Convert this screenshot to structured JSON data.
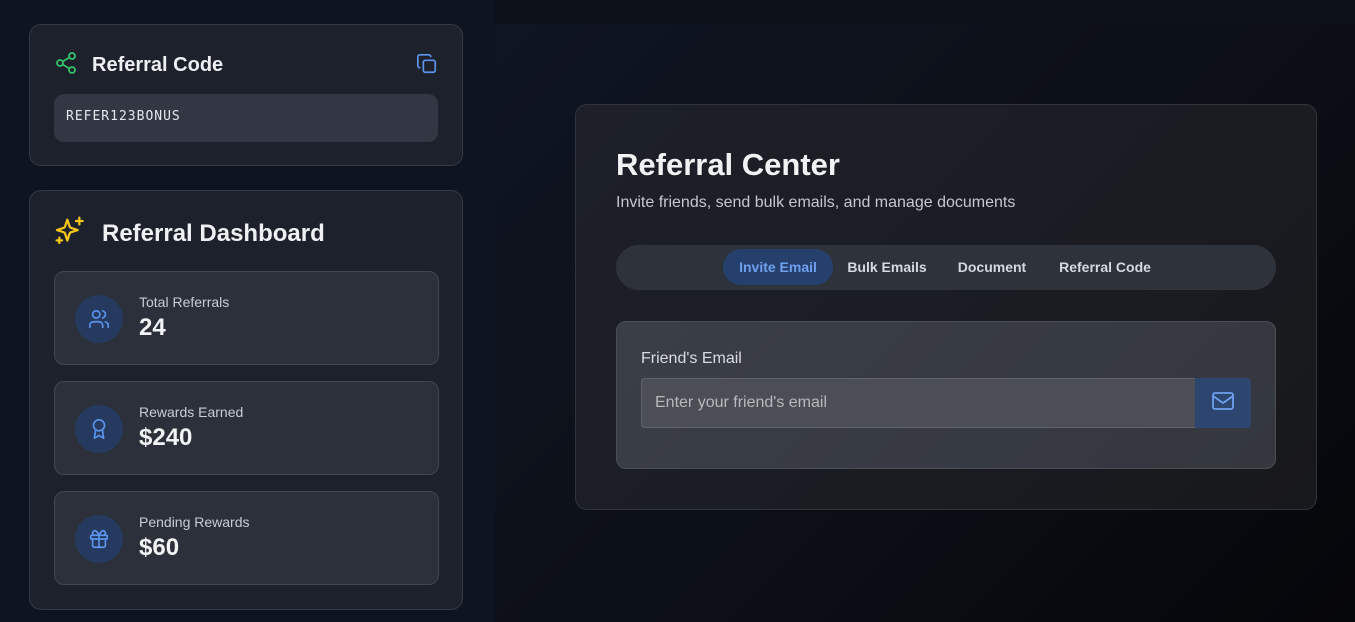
{
  "referral_code_card": {
    "title": "Referral Code",
    "code": "REFER123BONUS",
    "icon": "share-icon",
    "copy_icon": "copy-icon"
  },
  "dashboard": {
    "title": "Referral Dashboard",
    "icon": "sparkles-icon",
    "stats": [
      {
        "label": "Total Referrals",
        "value": "24",
        "icon": "users-icon"
      },
      {
        "label": "Rewards Earned",
        "value": "$240",
        "icon": "award-icon"
      },
      {
        "label": "Pending Rewards",
        "value": "$60",
        "icon": "gift-icon"
      }
    ]
  },
  "center": {
    "title": "Referral Center",
    "subtitle": "Invite friends, send bulk emails, and manage documents",
    "tabs": [
      {
        "label": "Invite Email",
        "active": true
      },
      {
        "label": "Bulk Emails",
        "active": false
      },
      {
        "label": "Document",
        "active": false
      },
      {
        "label": "Referral Code",
        "active": false
      }
    ],
    "form": {
      "label": "Friend's Email",
      "placeholder": "Enter your friend's email",
      "value": "",
      "send_icon": "mail-icon"
    }
  },
  "colors": {
    "accent": "#6ea0ee",
    "success": "#34c26b",
    "sparkle": "#f5c518"
  }
}
